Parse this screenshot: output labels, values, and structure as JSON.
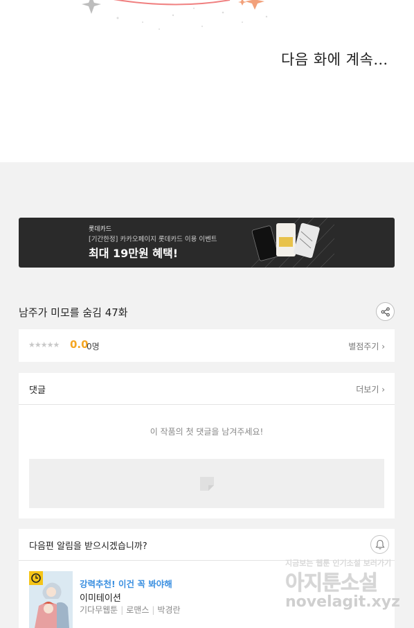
{
  "comic": {
    "to_be_continued": "다음 화에 계속…"
  },
  "banner": {
    "brand": "롯데카드",
    "description": "[기간한정] 카카오페이지 롯데카드 이용 이벤트",
    "headline": "최대 19만원 혜택!"
  },
  "episode": {
    "title": "남주가 미모를 숨김 47화",
    "share_icon": "share-icon"
  },
  "rating": {
    "stars": "★★★★★",
    "score": "0.0",
    "count": "0명",
    "rate_link": "별점주기 ›"
  },
  "comments": {
    "title": "댓글",
    "more_link": "더보기 ›",
    "empty_message": "이 작품의 첫 댓글을 남겨주세요!"
  },
  "notify": {
    "question": "다음편 알림을 받으시겠습니까?",
    "bell_icon": "bell-icon"
  },
  "recommendation": {
    "label": "강력추천! 이건 꼭 봐야해",
    "title": "이미테이션",
    "badge": "기다무웹툰",
    "genre": "로맨스",
    "author": "박경란"
  },
  "watermark": {
    "tagline": "지금보는 웹툰 인기소설 보러가기",
    "site_name": "아지툰소설",
    "url": "novelagit.xyz"
  },
  "colors": {
    "score": "#f5a623",
    "recommend_label": "#3a8fe0",
    "banner_bg": "#2a2a2a",
    "page_bg": "#f2f2f2"
  }
}
